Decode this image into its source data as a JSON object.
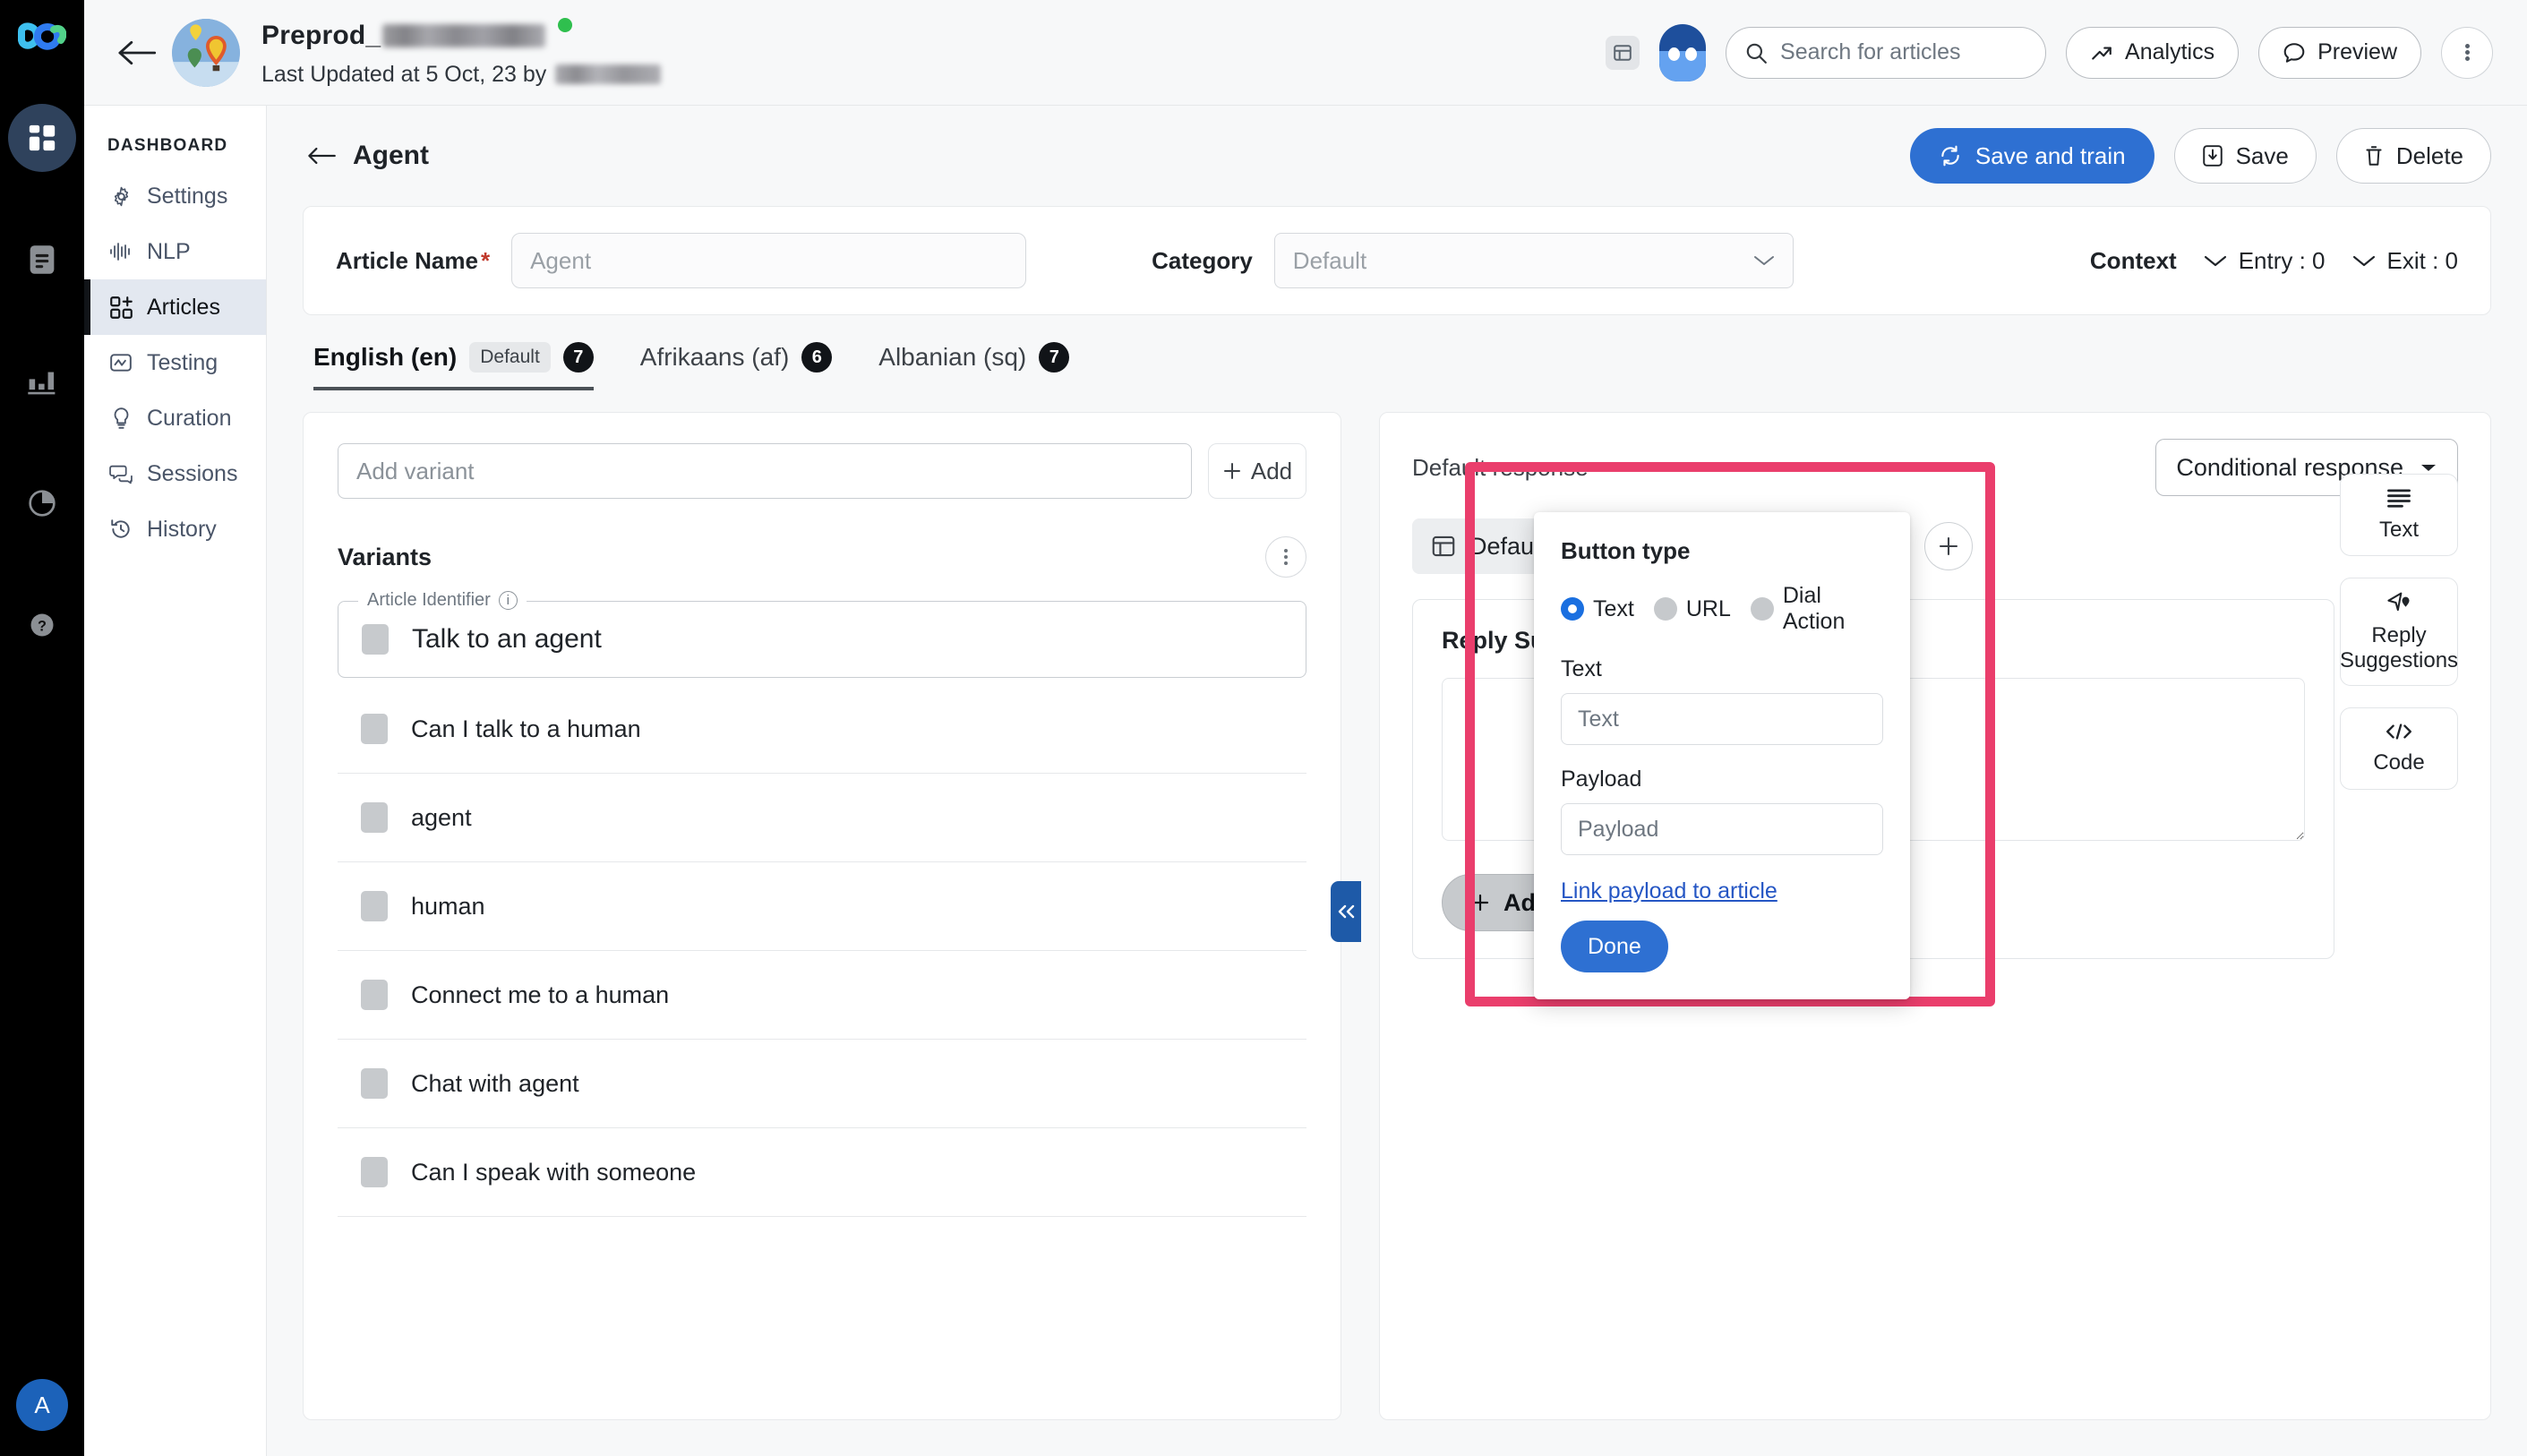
{
  "colors": {
    "accent_blue": "#2e70d2",
    "highlight_pink": "#ea3e6c",
    "rail_black": "#000000",
    "sidebar_active": "#e3e8f0",
    "status_green": "#2fbf4e",
    "link_blue": "#2556c4"
  },
  "rail": {
    "items": [
      {
        "icon": "grid-dashboard-icon",
        "active": true
      },
      {
        "icon": "document-icon",
        "active": false
      },
      {
        "icon": "bar-chart-icon",
        "active": false
      },
      {
        "icon": "pie-chart-icon",
        "active": false
      },
      {
        "icon": "help-question-icon",
        "active": false
      }
    ],
    "avatar_initial": "A"
  },
  "header": {
    "back_icon": "back-arrow-icon",
    "bot_avatar_icon": "hot-air-balloon-avatar",
    "project_title": "Preprod_",
    "project_title_redacted": true,
    "status": "online",
    "last_updated": "Last Updated at 5 Oct, 23 by",
    "last_updated_user_redacted": true,
    "book_icon": "book-icon",
    "assistant_icon": "ninja-assistant-icon",
    "search": {
      "icon": "search-icon",
      "value": "",
      "placeholder": "Search for articles"
    },
    "analytics_button": {
      "label": "Analytics",
      "icon": "trending-up-icon"
    },
    "preview_button": {
      "label": "Preview",
      "icon": "chat-bubble-icon"
    },
    "more_button": {
      "icon": "kebab-menu-icon"
    }
  },
  "sidebar": {
    "heading": "DASHBOARD",
    "items": [
      {
        "label": "Settings",
        "icon": "gear-icon",
        "active": false
      },
      {
        "label": "NLP",
        "icon": "waveform-icon",
        "active": false
      },
      {
        "label": "Articles",
        "icon": "articles-grid-plus-icon",
        "active": true
      },
      {
        "label": "Testing",
        "icon": "testing-wave-icon",
        "active": false
      },
      {
        "label": "Curation",
        "icon": "lightbulb-icon",
        "active": false
      },
      {
        "label": "Sessions",
        "icon": "chat-bubbles-icon",
        "active": false
      },
      {
        "label": "History",
        "icon": "clock-history-icon",
        "active": false
      }
    ]
  },
  "page": {
    "back_icon": "back-arrow-icon",
    "title": "Agent",
    "save_and_train_button": {
      "label": "Save and train",
      "icon": "refresh-cycle-icon"
    },
    "save_button": {
      "label": "Save",
      "icon": "save-download-icon"
    },
    "delete_button": {
      "label": "Delete",
      "icon": "trash-icon"
    }
  },
  "meta": {
    "article_name_label": "Article Name",
    "article_name_required_mark": "*",
    "article_name_value": "",
    "article_name_placeholder": "Agent",
    "category_label": "Category",
    "category_value": "",
    "category_placeholder": "Default",
    "category_caret_icon": "chevron-down-icon",
    "context_label": "Context",
    "entry_label": "Entry : 0",
    "exit_label": "Exit : 0",
    "entry_caret_icon": "chevron-down-icon",
    "exit_caret_icon": "chevron-down-icon"
  },
  "language_tabs": [
    {
      "label": "English (en)",
      "chip": "Default",
      "count": "7",
      "active": true
    },
    {
      "label": "Afrikaans (af)",
      "chip": "",
      "count": "6",
      "active": false
    },
    {
      "label": "Albanian (sq)",
      "chip": "",
      "count": "7",
      "active": false
    }
  ],
  "variants_panel": {
    "add_variant_input_value": "",
    "add_variant_placeholder": "Add variant",
    "add_button_label": "Add",
    "add_button_icon": "plus-icon",
    "variants_title": "Variants",
    "variants_menu_icon": "kebab-menu-icon",
    "article_identifier_legend": "Article Identifier",
    "article_identifier_info_icon": "info-icon",
    "article_identifier_value": "Talk to an agent",
    "items": [
      {
        "text": "Can I talk to a human"
      },
      {
        "text": "agent"
      },
      {
        "text": "human"
      },
      {
        "text": "Connect me to a human"
      },
      {
        "text": "Chat with agent"
      },
      {
        "text": "Can I speak with someone"
      }
    ]
  },
  "collapse_handle": {
    "icon": "double-chevron-left-icon"
  },
  "response_panel": {
    "default_response_label": "Default response",
    "conditional_response_label": "Conditional response",
    "conditional_response_caret_icon": "chevron-down-icon",
    "chip": {
      "icon": "card-layout-icon",
      "label": "Default Articles Business Messages",
      "delete_icon": "trash-icon"
    },
    "add_response_icon": "plus-icon",
    "reply_card_title": "Reply Suggestions",
    "reply_textarea_value": "",
    "reply_textarea_placeholder": "",
    "add_reply_suggestion_label": "Add Reply Suggestion",
    "add_reply_suggestion_icon": "plus-icon"
  },
  "tool_buttons": [
    {
      "label": "Text",
      "icon": "text-lines-icon"
    },
    {
      "label": "Reply Suggestions",
      "icon": "reply-cursor-icon"
    },
    {
      "label": "Code",
      "icon": "code-brackets-icon"
    }
  ],
  "popover": {
    "title": "Button type",
    "options": [
      {
        "label": "Text",
        "selected": true
      },
      {
        "label": "URL",
        "selected": false
      },
      {
        "label": "Dial Action",
        "selected": false
      }
    ],
    "text_label": "Text",
    "text_value": "",
    "text_placeholder": "Text",
    "payload_label": "Payload",
    "payload_value": "",
    "payload_placeholder": "Payload",
    "link_label": "Link payload to article",
    "done_label": "Done"
  }
}
